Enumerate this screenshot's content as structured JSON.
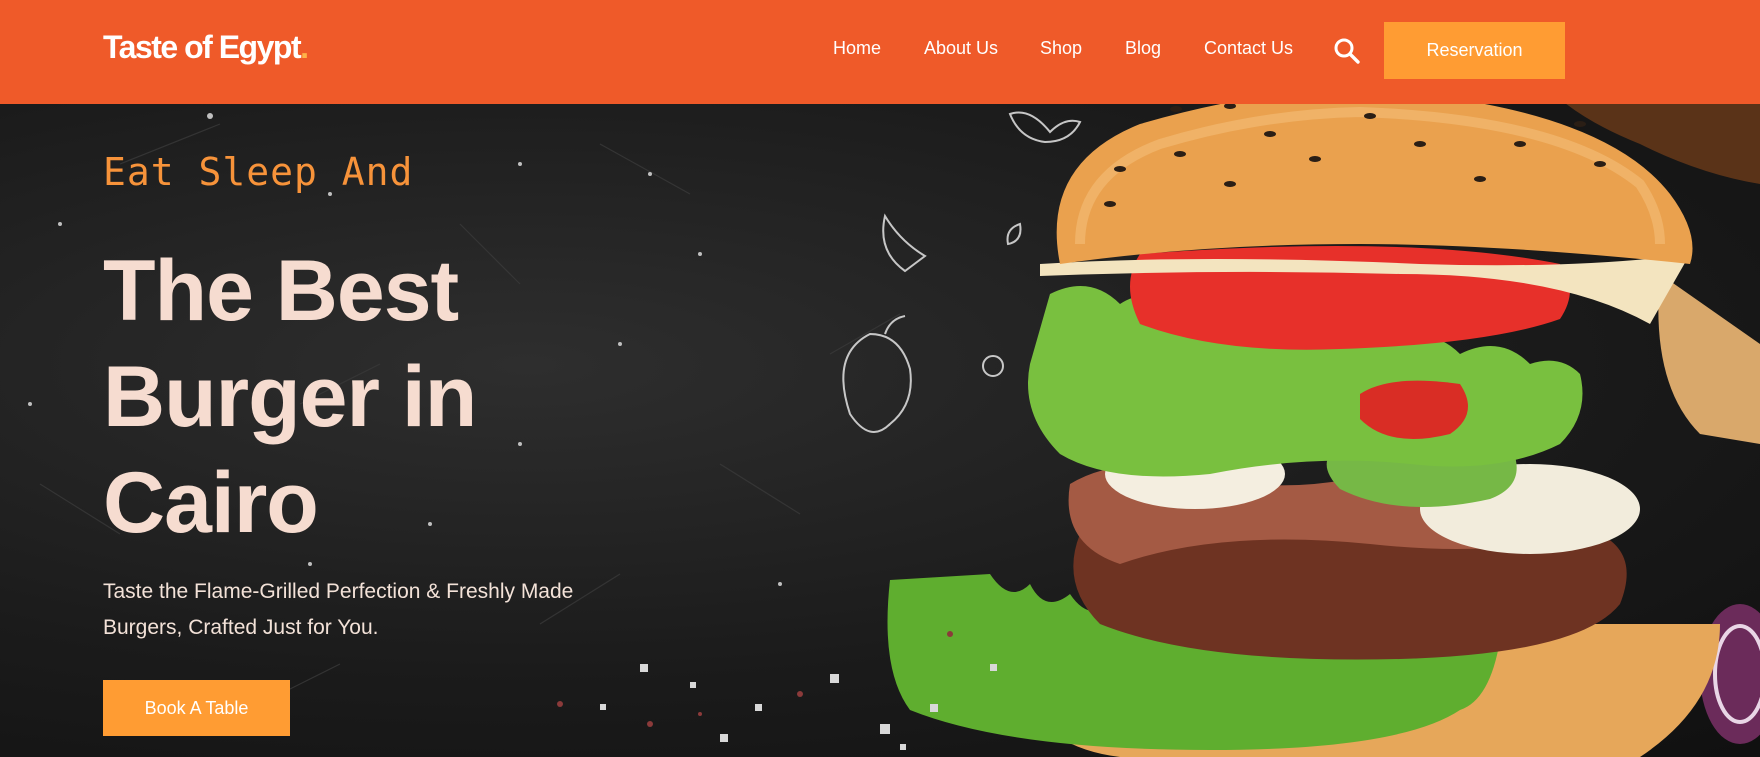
{
  "header": {
    "logo_text": "Taste of Egypt",
    "logo_dot": ".",
    "nav": [
      {
        "label": "Home"
      },
      {
        "label": "About Us"
      },
      {
        "label": "Shop"
      },
      {
        "label": "Blog"
      },
      {
        "label": "Contact Us"
      }
    ],
    "search_icon": "search-icon",
    "reservation_label": "Reservation"
  },
  "hero": {
    "tagline": "Eat Sleep And",
    "headline": "The Best Burger in Cairo",
    "subtitle": "Taste the Flame-Grilled Perfection & Freshly Made Burgers, Crafted Just for You.",
    "cta_label": "Book A Table"
  },
  "colors": {
    "header_bg": "#ef5a29",
    "button_bg": "#ff9c33",
    "tagline": "#f7933a",
    "headline": "#f6dcd0"
  }
}
